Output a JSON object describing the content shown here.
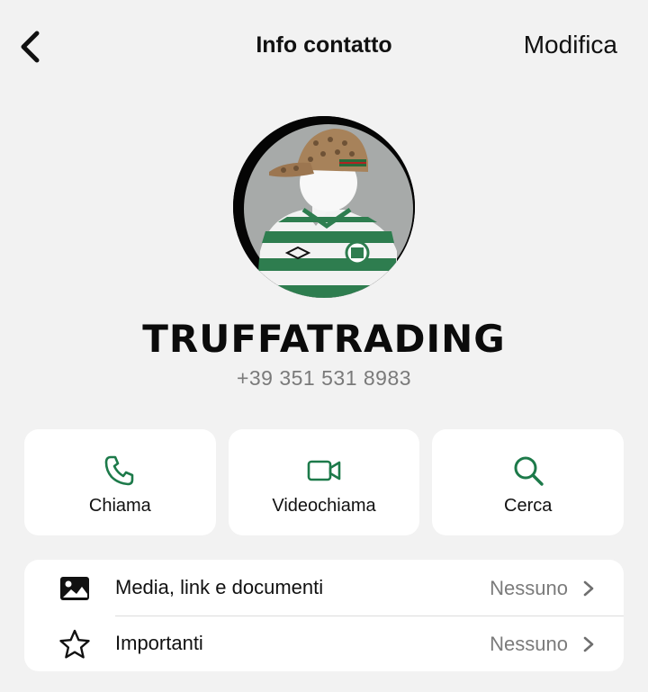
{
  "header": {
    "back_icon": "chevron-left-icon",
    "title": "Info contatto",
    "edit_label": "Modifica"
  },
  "contact": {
    "name": "TRUFFATRADING",
    "phone": "+39 351 531 8983"
  },
  "actions": [
    {
      "label": "Chiama",
      "icon": "phone-icon"
    },
    {
      "label": "Videochiama",
      "icon": "video-camera-icon"
    },
    {
      "label": "Cerca",
      "icon": "search-icon"
    }
  ],
  "list": [
    {
      "label": "Media, link e documenti",
      "value": "Nessuno",
      "icon": "image-icon"
    },
    {
      "label": "Importanti",
      "value": "Nessuno",
      "icon": "star-icon"
    }
  ],
  "colors": {
    "accent": "#1d7a4a",
    "background": "#f2f2f2",
    "secondary_text": "#7b7b7b"
  }
}
